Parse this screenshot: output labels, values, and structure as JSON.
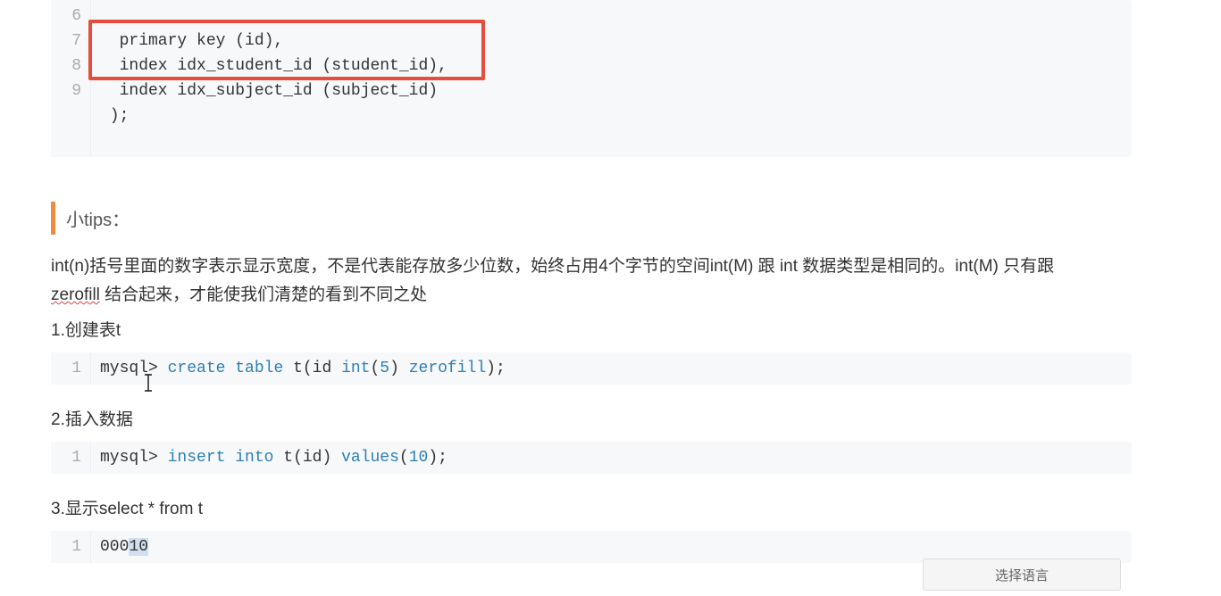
{
  "codeblock1": {
    "lines": [
      {
        "n": 6,
        "segments": [
          {
            "t": "  primary key (id),",
            "c": ""
          }
        ]
      },
      {
        "n": 7,
        "segments": [
          {
            "t": "  index idx_student_id (student_id),",
            "c": ""
          }
        ]
      },
      {
        "n": 8,
        "segments": [
          {
            "t": "  index idx_subject_id (subject_id)",
            "c": ""
          }
        ]
      },
      {
        "n": 9,
        "segments": [
          {
            "t": " );",
            "c": ""
          }
        ]
      }
    ]
  },
  "tips_label": "小tips：",
  "para1_seg1": " int(n)括号里面的数字表示显示宽度，不是代表能存放多少位数，始终占用4个字节的空间int(M) 跟 int 数据类型是相同的。int(M) 只有跟 ",
  "para1_zerofill": "zerofill",
  "para1_seg2": " 结合起来，才能使我们清楚的看到不同之处",
  "step1": "1.创建表t",
  "codeblock2": {
    "lineno": "1",
    "seg_mysql": "mysql",
    "seg_gt": "> ",
    "seg_create": "create",
    "seg_sp1": " ",
    "seg_table": "table",
    "seg_tid": " t(id ",
    "seg_int": "int",
    "seg_paren_open": "(",
    "seg_5": "5",
    "seg_paren_close": ") ",
    "seg_zerofill": "zerofill",
    "seg_end": ");"
  },
  "step2": "2.插入数据",
  "codeblock3": {
    "lineno": "1",
    "seg_mysql": "mysql> ",
    "seg_insert": "insert",
    "seg_sp1": " ",
    "seg_into": "into",
    "seg_tid": " t(id) ",
    "seg_values": "values",
    "seg_paren_open": "(",
    "seg_10": "10",
    "seg_end": ");"
  },
  "step3": "3.显示select * from t",
  "codeblock4": {
    "lineno": "1",
    "seg_000": "000",
    "seg_10": "10"
  },
  "footer_button": "选择语言"
}
